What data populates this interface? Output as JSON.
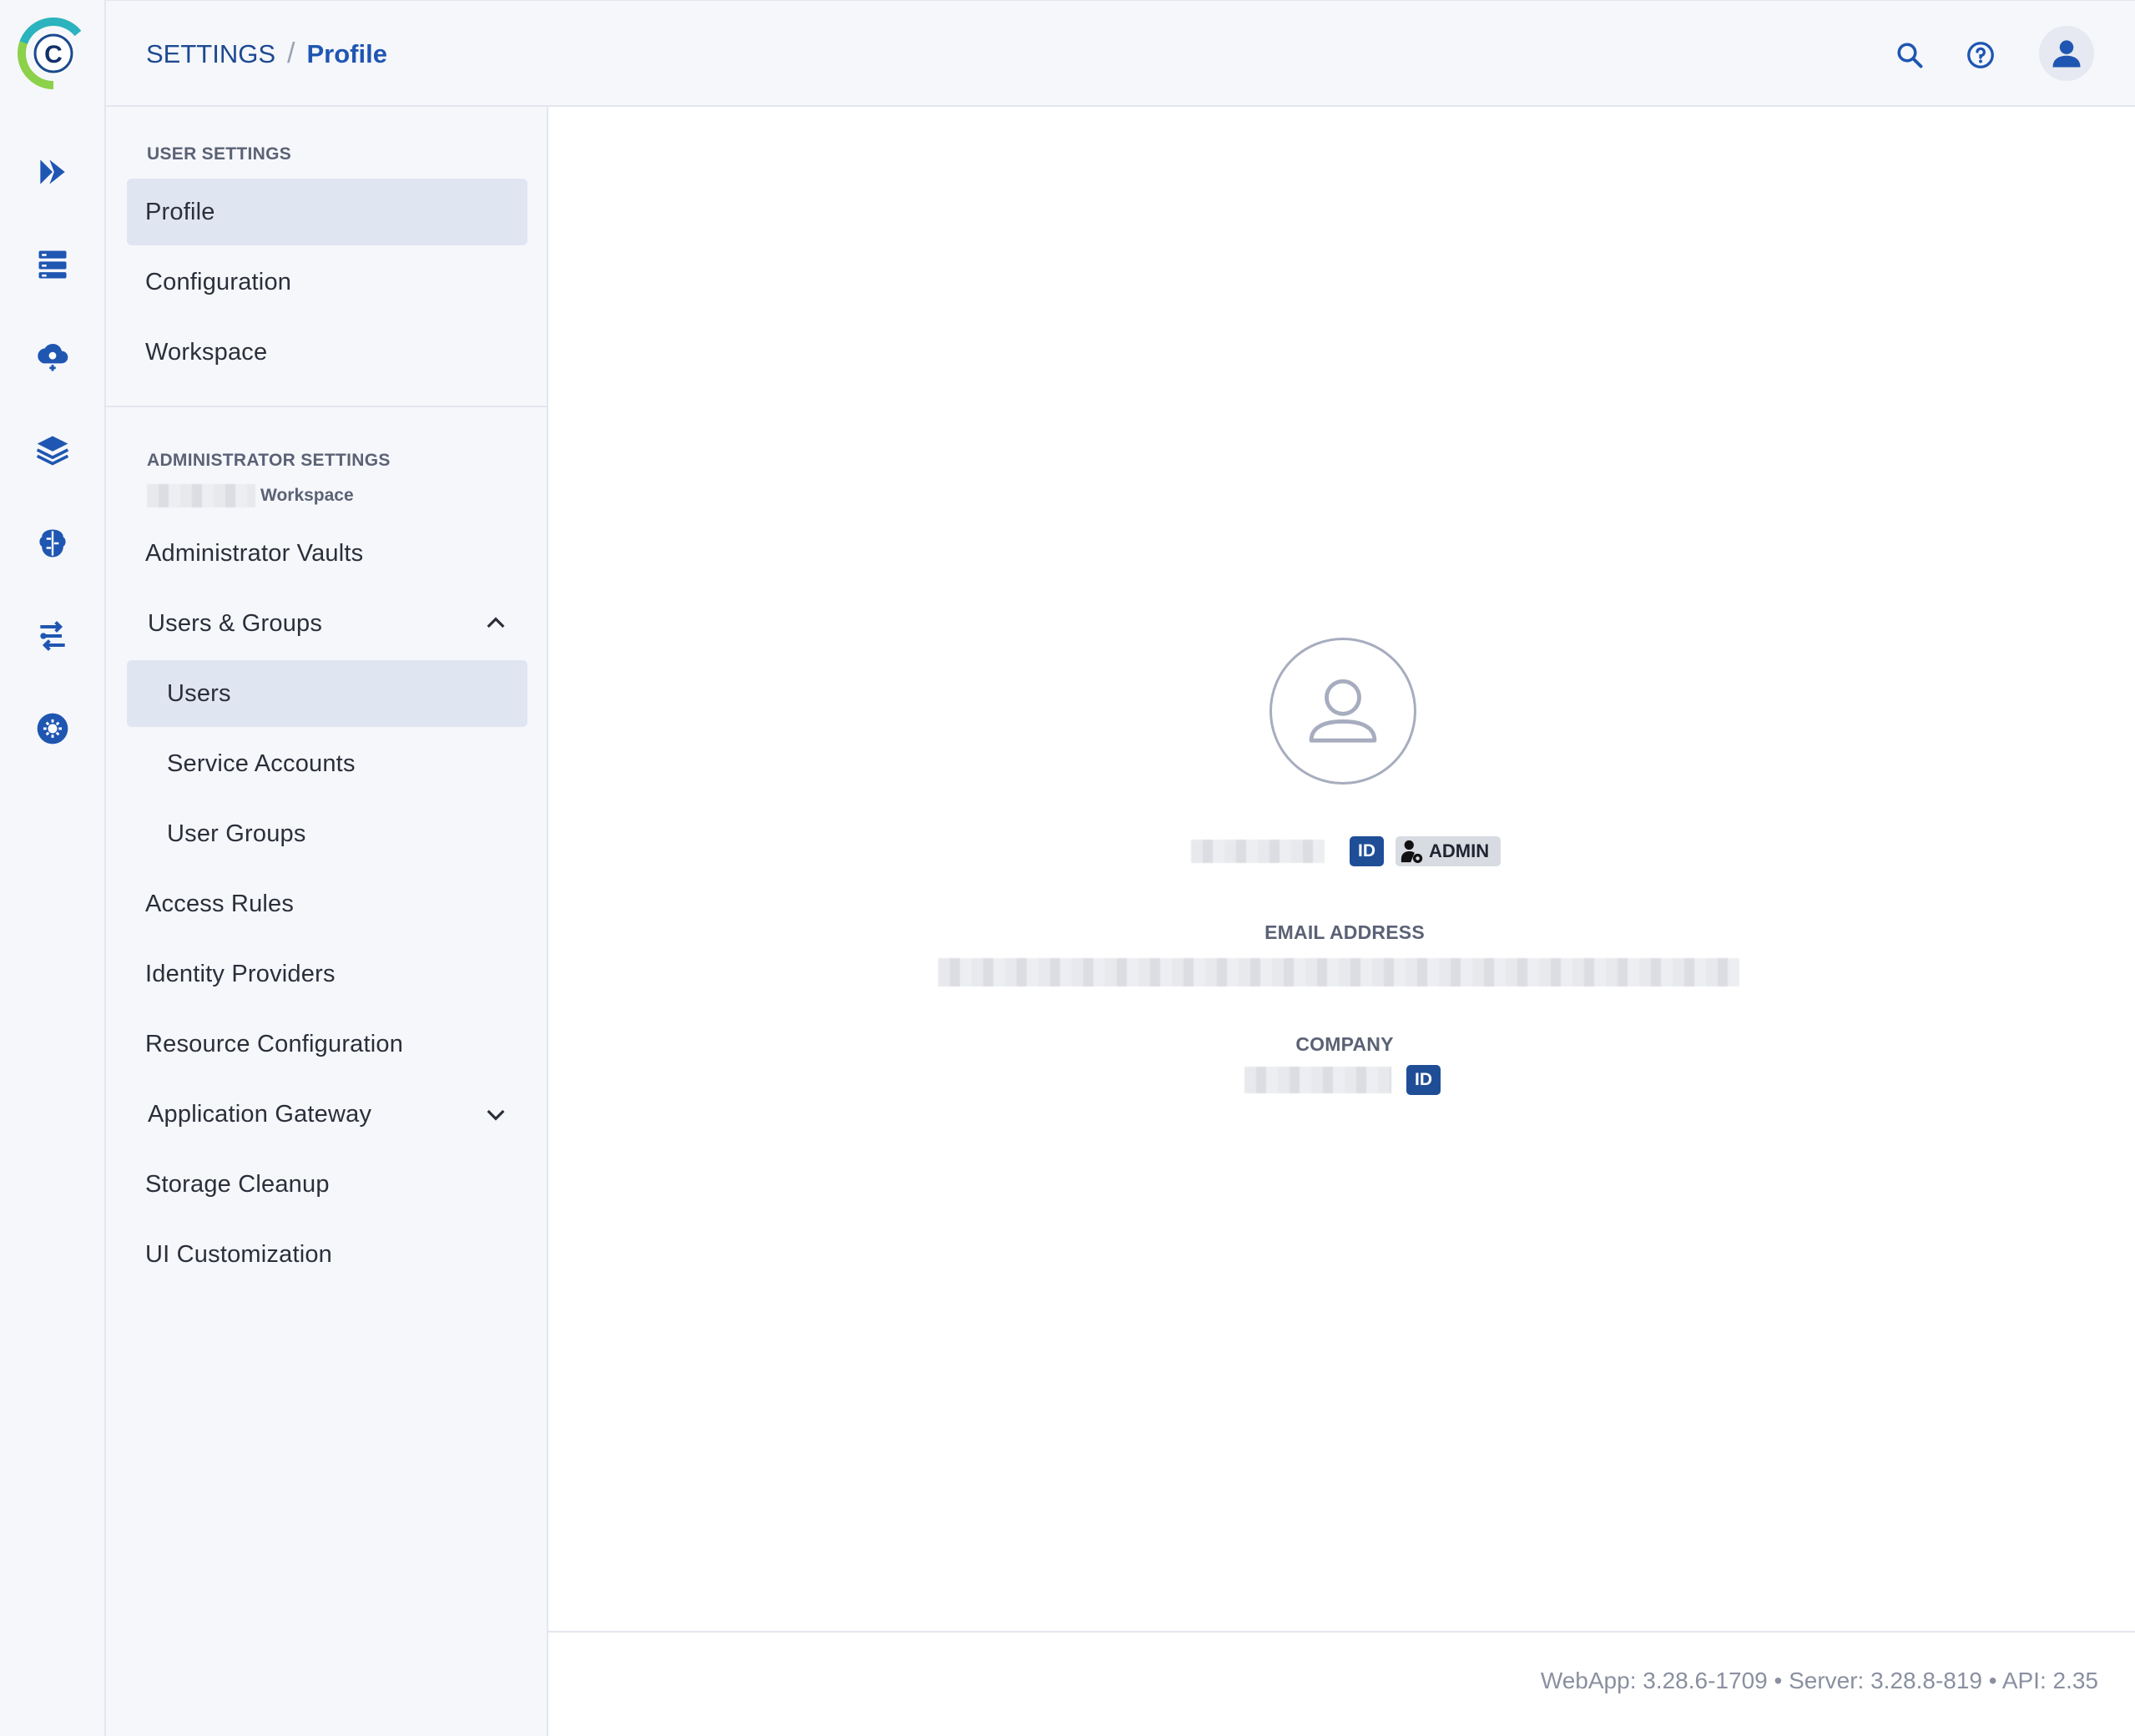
{
  "header": {
    "breadcrumb_root": "SETTINGS",
    "breadcrumb_separator": "/",
    "breadcrumb_current": "Profile"
  },
  "rail": {
    "items": [
      {
        "name": "pipelines-icon"
      },
      {
        "name": "datasets-icon"
      },
      {
        "name": "cloud-orchestration-icon"
      },
      {
        "name": "layers-icon"
      },
      {
        "name": "brain-icon"
      },
      {
        "name": "workflow-icon"
      },
      {
        "name": "settings-icon"
      }
    ]
  },
  "sidebar": {
    "user_settings_title": "USER SETTINGS",
    "user_items": [
      "Profile",
      "Configuration",
      "Workspace"
    ],
    "admin_settings_title": "ADMINISTRATOR SETTINGS",
    "admin_workspace_suffix": "Workspace",
    "admin_items": {
      "administrator_vaults": "Administrator Vaults",
      "users_groups": "Users & Groups",
      "users": "Users",
      "service_accounts": "Service Accounts",
      "user_groups": "User Groups",
      "access_rules": "Access Rules",
      "identity_providers": "Identity Providers",
      "resource_configuration": "Resource Configuration",
      "application_gateway": "Application Gateway",
      "storage_cleanup": "Storage Cleanup",
      "ui_customization": "UI Customization"
    }
  },
  "profile": {
    "id_badge": "ID",
    "role_badge": "ADMIN",
    "email_label": "EMAIL ADDRESS",
    "company_label": "COMPANY",
    "company_id_badge": "ID"
  },
  "footer": {
    "version": "WebApp: 3.28.6-1709 • Server: 3.28.8-819 • API: 2.35"
  },
  "colors": {
    "brand_blue": "#1f56b2",
    "badge_blue": "#1f4e96",
    "active_bg": "#dfe6f1"
  }
}
